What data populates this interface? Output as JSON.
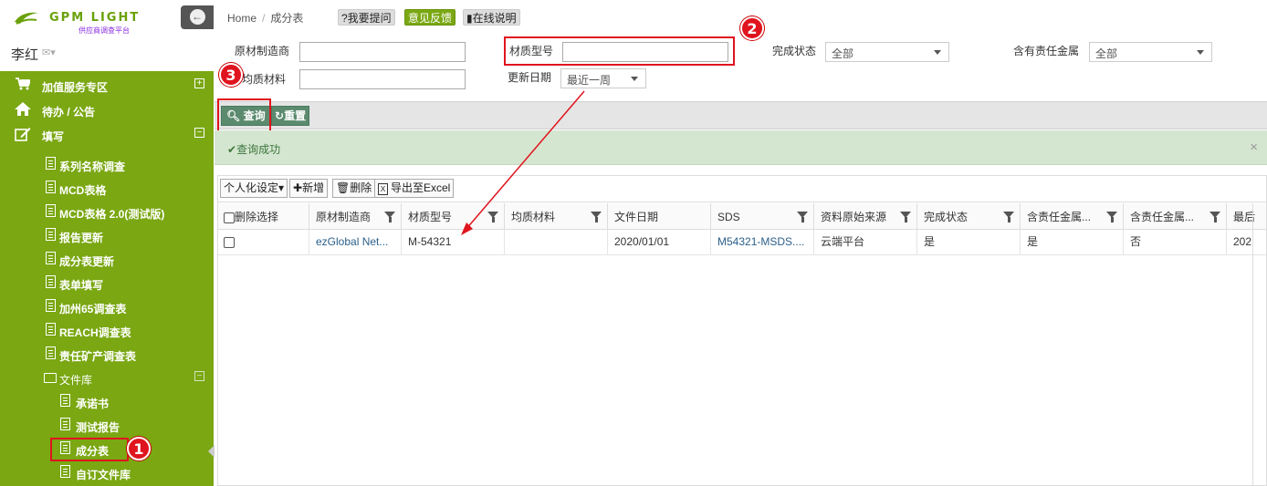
{
  "logo": {
    "text": "GPM LIGHT",
    "sub": "供应商调查平台"
  },
  "user": {
    "name": "李红"
  },
  "nav": {
    "top": [
      {
        "label": "加值服务专区",
        "icon": "cart-icon",
        "exp": "+"
      },
      {
        "label": "待办 / 公告",
        "icon": "home-icon"
      },
      {
        "label": "填写",
        "icon": "edit-icon",
        "exp": "−"
      }
    ],
    "sub": [
      {
        "label": "系列名称调查"
      },
      {
        "label": "MCD表格"
      },
      {
        "label": "MCD表格 2.0(测试版)"
      },
      {
        "label": "报告更新"
      },
      {
        "label": "成分表更新"
      },
      {
        "label": "表单填写"
      },
      {
        "label": "加州65调查表"
      },
      {
        "label": "REACH调查表"
      },
      {
        "label": "责任矿产调查表"
      }
    ],
    "folder": {
      "label": "文件库",
      "exp": "−"
    },
    "files": [
      {
        "label": "承诺书"
      },
      {
        "label": "测试报告"
      },
      {
        "label": "成分表"
      },
      {
        "label": "自订文件库"
      }
    ]
  },
  "breadcrumb": {
    "home": "Home",
    "sep": "/",
    "current": "成分表"
  },
  "top_buttons": {
    "ask": "?我要提问",
    "feedback": "意见反馈",
    "manual": "在线说明"
  },
  "form": {
    "manufacturer": {
      "label": "原材制造商",
      "value": ""
    },
    "material_no": {
      "label": "材质型号",
      "value": ""
    },
    "status": {
      "label": "完成状态",
      "value": "全部"
    },
    "metal": {
      "label": "含有责任金属",
      "value": "全部"
    },
    "homogeneous": {
      "label": "均质材料",
      "value": ""
    },
    "update_date": {
      "label": "更新日期",
      "value": "最近一周"
    }
  },
  "actions": {
    "search": "查询",
    "reset": "重置"
  },
  "alert": {
    "text": "查询成功",
    "close": "×"
  },
  "grid_tools": {
    "personal": "个人化设定▾",
    "add": "新增",
    "delete": "删除",
    "export": "导出至Excel"
  },
  "columns": [
    "删除选择",
    "原材制造商",
    "材质型号",
    "均质材料",
    "文件日期",
    "SDS",
    "资料原始来源",
    "完成状态",
    "含责任金属...",
    "含责任金属...",
    "最后"
  ],
  "rows": [
    [
      "",
      "ezGlobal Net...",
      "M-54321",
      "",
      "2020/01/01",
      "M54321-MSDS....",
      "云端平台",
      "是",
      "是",
      "否",
      "202"
    ]
  ],
  "badges": [
    "1",
    "2",
    "3"
  ],
  "colors": {
    "sidebar_green": "#7aa712",
    "annotation_red": "#e0141e",
    "alert_bg": "#d5e6d0"
  }
}
